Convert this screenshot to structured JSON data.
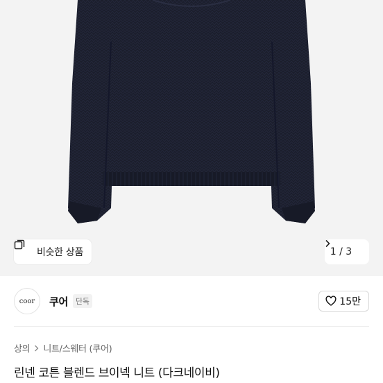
{
  "image_viewer": {
    "similar_label": "비슷한 상품",
    "similar_icon": "similar-items-icon",
    "pager": "1 / 3",
    "next_icon": "chevron-right-icon"
  },
  "shop": {
    "logo_text": "coor",
    "name": "쿠어",
    "badge": "단독",
    "like_icon": "heart-outline-icon",
    "likes": "15만"
  },
  "breadcrumb": {
    "items": [
      "상의",
      "니트/스웨터 (쿠어)"
    ],
    "separator_icon": "chevron-right-icon"
  },
  "product": {
    "title": "린넨 코튼 블렌드 브이넥 니트 (다크네이비)",
    "color": "#1a1d2b"
  },
  "colors": {
    "image_background": "#f3f3f3",
    "chip_background": "#ffffff",
    "badge_background": "#f2f2f2"
  }
}
